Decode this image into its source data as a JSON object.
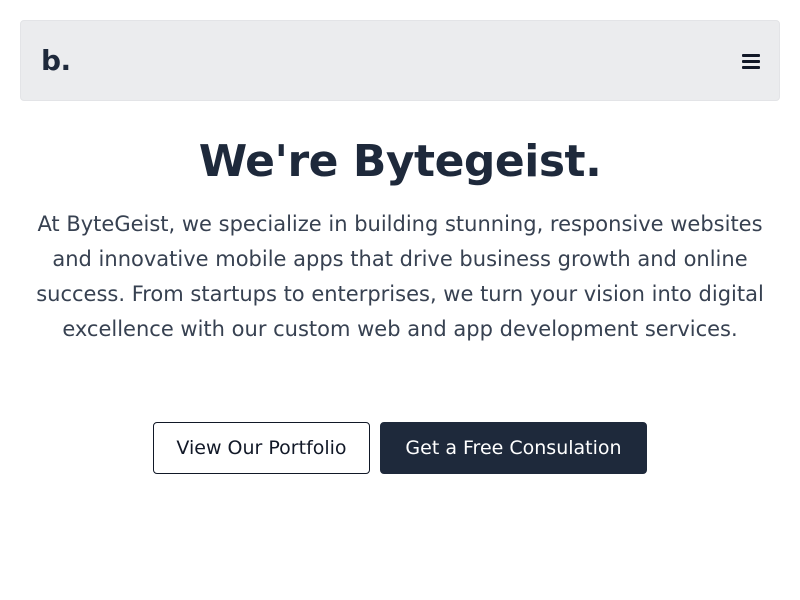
{
  "header": {
    "logo_text": "b.",
    "menu_icon": "hamburger-menu-icon"
  },
  "hero": {
    "title": "We're Bytegeist.",
    "description": "At ByteGeist, we specialize in building stunning, responsive websites and innovative mobile apps that drive business growth and online success. From startups to enterprises, we turn your vision into digital excellence with our custom web and app development services."
  },
  "actions": {
    "portfolio_label": "View Our Portfolio",
    "consultation_label": "Get a Free Consulation"
  },
  "colors": {
    "primary": "#1e293b",
    "navbar_bg": "#ebecee",
    "text_muted": "#374151",
    "background": "#ffffff"
  }
}
